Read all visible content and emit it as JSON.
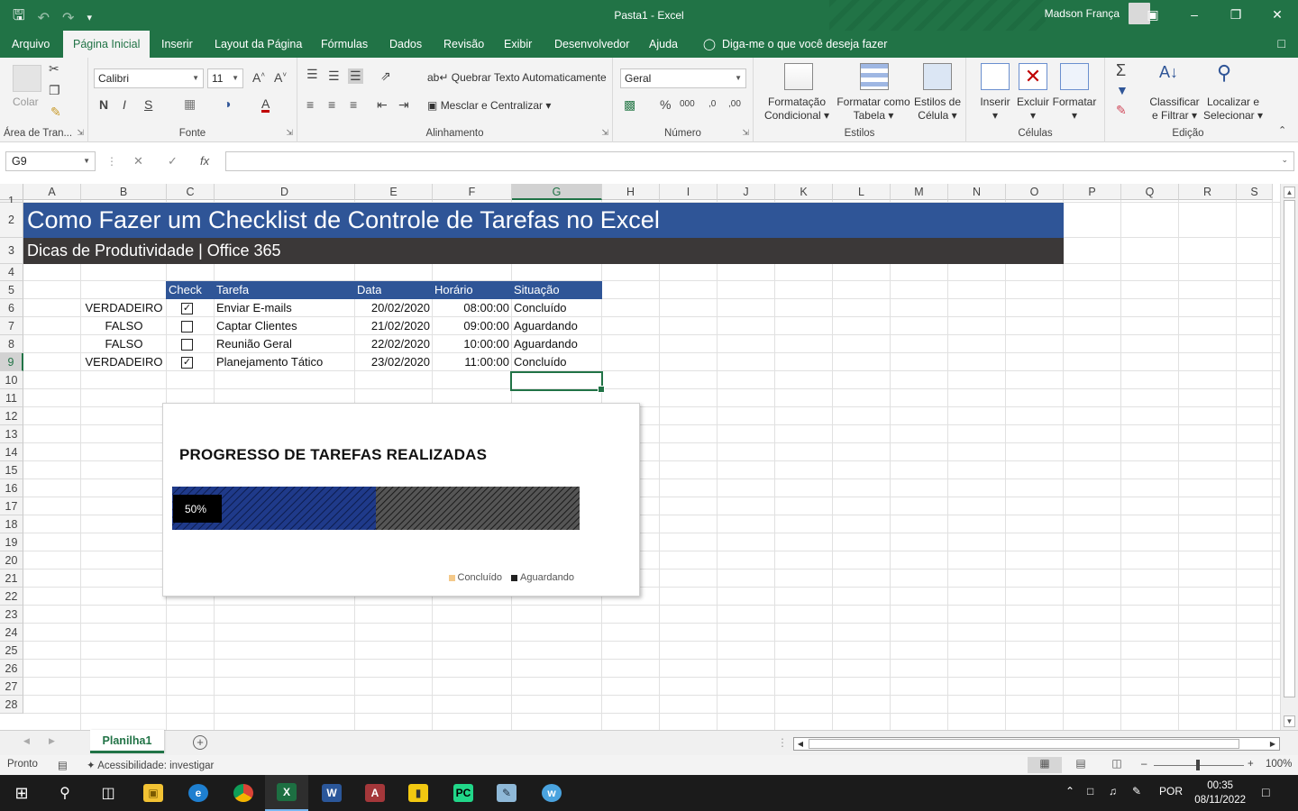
{
  "window": {
    "title": "Pasta1  -  Excel",
    "user": "Madson França"
  },
  "tabs": [
    "Arquivo",
    "Página Inicial",
    "Inserir",
    "Layout da Página",
    "Fórmulas",
    "Dados",
    "Revisão",
    "Exibir",
    "Desenvolvedor",
    "Ajuda"
  ],
  "tell_me": "Diga-me o que você deseja fazer",
  "ribbon": {
    "clipboard": {
      "paste": "Colar",
      "label": "Área de Tran..."
    },
    "font": {
      "name": "Calibri",
      "size": "11",
      "bold": "N",
      "italic": "I",
      "underline": "S",
      "grow": "A",
      "label": "Fonte"
    },
    "alignment": {
      "wrap": "Quebrar Texto Automaticamente",
      "merge": "Mesclar e Centralizar",
      "label": "Alinhamento"
    },
    "number": {
      "format": "Geral",
      "percent": "%",
      "thousands": "000",
      "inc_dec": ",0",
      "dec_dec": ",00",
      "label": "Número"
    },
    "styles": {
      "conditional": [
        "Formatação",
        "Condicional"
      ],
      "as_table": [
        "Formatar como",
        "Tabela"
      ],
      "cell_styles": [
        "Estilos de",
        "Célula"
      ],
      "label": "Estilos"
    },
    "cells": {
      "insert": "Inserir",
      "delete": "Excluir",
      "format": "Formatar",
      "label": "Células"
    },
    "editing": {
      "sort": [
        "Classificar",
        "e Filtrar"
      ],
      "find": [
        "Localizar e",
        "Selecionar"
      ],
      "label": "Edição"
    }
  },
  "formula_bar": {
    "name_box": "G9",
    "fx": "fx",
    "value": ""
  },
  "columns": [
    "A",
    "B",
    "C",
    "D",
    "E",
    "F",
    "G",
    "H",
    "I",
    "J",
    "K",
    "L",
    "M",
    "N",
    "O",
    "P",
    "Q",
    "R",
    "S"
  ],
  "rows": [
    "1",
    "2",
    "3",
    "4",
    "5",
    "6",
    "7",
    "8",
    "9",
    "10",
    "11",
    "12",
    "13",
    "14",
    "15",
    "16",
    "17",
    "18",
    "19",
    "20",
    "21",
    "22",
    "23",
    "24",
    "25",
    "26",
    "27",
    "28"
  ],
  "sheet": {
    "title": "Como Fazer um Checklist de Controle de Tarefas no Excel",
    "subtitle": "Dicas de Produtividade | Office 365",
    "headers": [
      "Check",
      "Tarefa",
      "Data",
      "Horário",
      "Situação"
    ],
    "tasks": [
      {
        "flag": "VERDADEIRO",
        "checked": true,
        "task": "Enviar E-mails",
        "date": "20/02/2020",
        "time": "08:00:00",
        "status": "Concluído"
      },
      {
        "flag": "FALSO",
        "checked": false,
        "task": "Captar Clientes",
        "date": "21/02/2020",
        "time": "09:00:00",
        "status": "Aguardando"
      },
      {
        "flag": "FALSO",
        "checked": false,
        "task": "Reunião Geral",
        "date": "22/02/2020",
        "time": "10:00:00",
        "status": "Aguardando"
      },
      {
        "flag": "VERDADEIRO",
        "checked": true,
        "task": "Planejamento Tático",
        "date": "23/02/2020",
        "time": "11:00:00",
        "status": "Concluído"
      }
    ],
    "checkmark": "✓"
  },
  "chart_data": {
    "type": "bar",
    "orientation": "horizontal-stacked",
    "title": "PROGRESSO DE TAREFAS REALIZADAS",
    "series": [
      {
        "name": "Concluído",
        "values": [
          50
        ],
        "color": "#1f3a8a"
      },
      {
        "name": "Aguardando",
        "values": [
          50
        ],
        "color": "#3a3a3a"
      }
    ],
    "data_label": "50%",
    "legend_placement": "bottom-right",
    "legend_swatches": [
      "#f4c98a",
      "#222222"
    ],
    "grid": false
  },
  "sheet_tabs": [
    "Planilha1"
  ],
  "status": {
    "ready": "Pronto",
    "accessibility": "Acessibilidade: investigar",
    "zoom": "100%"
  },
  "taskbar": {
    "lang": "POR",
    "time": "00:35",
    "date": "08/11/2022"
  }
}
